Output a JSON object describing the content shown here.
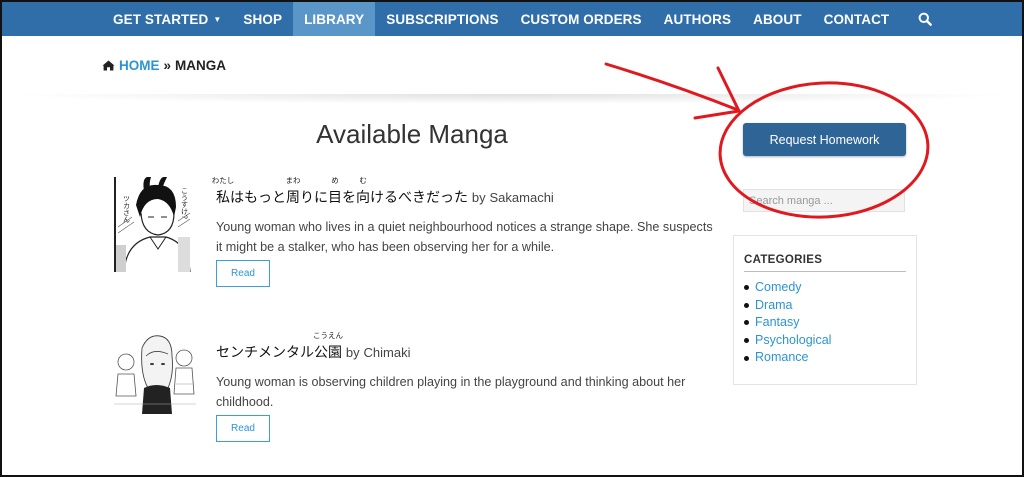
{
  "nav": {
    "items": [
      {
        "label": "GET STARTED",
        "dropdown": true,
        "active": false
      },
      {
        "label": "SHOP",
        "dropdown": false,
        "active": false
      },
      {
        "label": "LIBRARY",
        "dropdown": false,
        "active": true
      },
      {
        "label": "SUBSCRIPTIONS",
        "dropdown": false,
        "active": false
      },
      {
        "label": "CUSTOM ORDERS",
        "dropdown": false,
        "active": false
      },
      {
        "label": "AUTHORS",
        "dropdown": false,
        "active": false
      },
      {
        "label": "ABOUT",
        "dropdown": false,
        "active": false
      },
      {
        "label": "CONTACT",
        "dropdown": false,
        "active": false
      }
    ],
    "search_icon": "search-icon",
    "bg_color": "#2f6ea8",
    "active_color": "#5b96c9"
  },
  "breadcrumb": {
    "home_icon": "home-icon",
    "home": "HOME",
    "separator": "»",
    "current": "MANGA"
  },
  "main": {
    "title": "Available Manga",
    "manga": [
      {
        "title_segments": [
          {
            "text": "私",
            "ruby": "わたし"
          },
          {
            "text": "はもっと"
          },
          {
            "text": "周",
            "ruby": "まわ"
          },
          {
            "text": "りに"
          },
          {
            "text": "目",
            "ruby": "め"
          },
          {
            "text": "を"
          },
          {
            "text": "向",
            "ruby": "む"
          },
          {
            "text": "けるべきだった"
          }
        ],
        "by": "by",
        "author": "Sakamachi",
        "description": "Young woman who lives in a quiet neighbourhood notices a strange shape. She suspects it might be a stalker, who has been observing her for a while.",
        "read_label": "Read",
        "cover_text": [
          "ツカさん",
          "こうすけ?"
        ]
      },
      {
        "title_segments": [
          {
            "text": "センチメンタル"
          },
          {
            "text": "公園",
            "ruby": "こうえん"
          }
        ],
        "by": "by",
        "author": "Chimaki",
        "description": "Young woman is observing children playing in the playground and thinking about her childhood.",
        "read_label": "Read"
      }
    ]
  },
  "sidebar": {
    "request_label": "Request Homework",
    "search_placeholder": "Search manga ...",
    "categories_title": "CATEGORIES",
    "categories": [
      "Comedy",
      "Drama",
      "Fantasy",
      "Psychological",
      "Romance"
    ]
  },
  "colors": {
    "link": "#2b95d3",
    "button": "#2f6596",
    "annotation": "#e0191f"
  }
}
